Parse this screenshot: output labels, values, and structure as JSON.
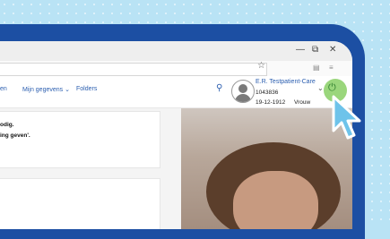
{
  "nav": {
    "item_partial": "en",
    "mijn_gegevens": "Mijn gegevens ⌄",
    "folders": "Folders"
  },
  "patient": {
    "name": "E.R. Testpatient-Care",
    "id": "1043836",
    "dob": "19-12-1912",
    "sex": "Vrouw"
  },
  "content": {
    "line1": "odig.",
    "line2": "ing geven'."
  },
  "icons": {
    "search": "search-icon",
    "power": "power-icon",
    "avatar": "user-avatar",
    "star": "bookmark-star-icon",
    "cursor": "pointer-cursor"
  },
  "colors": {
    "background": "#b9e3f5",
    "frame": "#1c4fa3",
    "link": "#2c5fb0",
    "highlight": "#78c850"
  }
}
